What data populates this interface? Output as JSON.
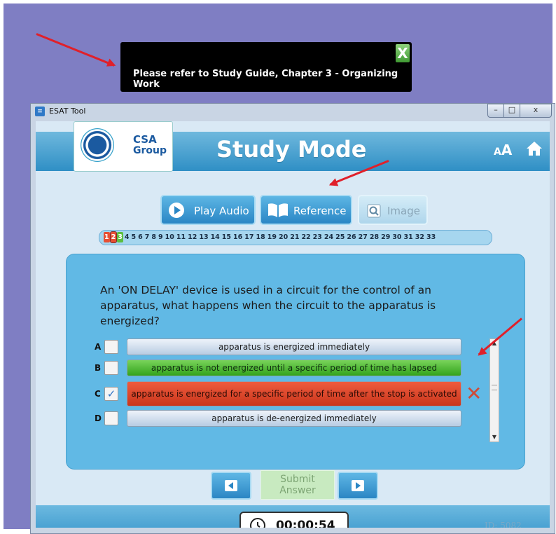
{
  "tooltip": {
    "text": "Please refer to Study Guide, Chapter 3 - Organizing Work",
    "close": "X"
  },
  "window": {
    "title": "ESAT Tool",
    "min": "–",
    "max": "□",
    "close": "x"
  },
  "logo": {
    "line1": "CSA",
    "line2": "Group"
  },
  "header": {
    "title": "Study Mode",
    "font_large": "A",
    "font_small": "A"
  },
  "toolbar": {
    "play_audio": "Play Audio",
    "reference": "Reference",
    "image": "Image"
  },
  "question_nav": {
    "numbers": [
      "1",
      "2",
      "3",
      "4",
      "5",
      "6",
      "7",
      "8",
      "9",
      "10",
      "11",
      "12",
      "13",
      "14",
      "15",
      "16",
      "17",
      "18",
      "19",
      "20",
      "21",
      "22",
      "23",
      "24",
      "25",
      "26",
      "27",
      "28",
      "29",
      "30",
      "31",
      "32",
      "33"
    ],
    "wrong": [
      "1",
      "2"
    ],
    "correct": [
      "3"
    ],
    "current": "2"
  },
  "question": {
    "text": "An 'ON DELAY' device is used in a circuit for the control of an apparatus, what happens when the circuit to the apparatus is energized?"
  },
  "answers": [
    {
      "letter": "A",
      "text": "apparatus is energized immediately",
      "state": "normal",
      "checked": false
    },
    {
      "letter": "B",
      "text": "apparatus is not energized until a specific period of time has lapsed",
      "state": "correct",
      "checked": false
    },
    {
      "letter": "C",
      "text": "apparatus is energized for a specific period of time after the stop is activated",
      "state": "wrong",
      "checked": true
    },
    {
      "letter": "D",
      "text": "apparatus is de-energized immediately",
      "state": "normal",
      "checked": false
    }
  ],
  "wrong_mark": "✕",
  "check_glyph": "✓",
  "submit": {
    "line1": "Submit",
    "line2": "Answer"
  },
  "timer": {
    "value": "00:00:54"
  },
  "id_label": "ID: 5082",
  "colors": {
    "accent": "#2f8fc5",
    "correct": "#32a31c",
    "wrong": "#d04a36",
    "arrow": "#e0202a"
  }
}
